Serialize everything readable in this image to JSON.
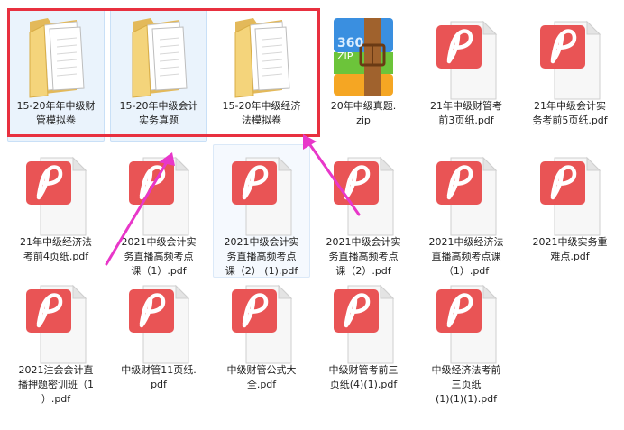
{
  "window": {
    "view": "large-icons",
    "selected_items": [
      "folder-mgmt-mock",
      "folder-accounting-real"
    ]
  },
  "files": [
    {
      "id": "folder-mgmt-mock",
      "type": "folder",
      "icon": "folder-icon",
      "label": "15-20年年中级财\n管模拟卷"
    },
    {
      "id": "folder-accounting-real",
      "type": "folder",
      "icon": "folder-icon",
      "label": "15-20年中级会计\n实务真题"
    },
    {
      "id": "folder-law-mock",
      "type": "folder",
      "icon": "folder-icon",
      "label": "15-20年中级经济\n法模拟卷"
    },
    {
      "id": "zip-2020-real",
      "type": "zip",
      "icon": "zip-archive-icon",
      "label": "20年中级真题.\nzip"
    },
    {
      "id": "pdf-fin-3p",
      "type": "pdf",
      "icon": "pdf-file-icon",
      "label": "21年中级财管考\n前3页纸.pdf"
    },
    {
      "id": "pdf-acc-5p",
      "type": "pdf",
      "icon": "pdf-file-icon",
      "label": "21年中级会计实\n务考前5页纸.pdf"
    },
    {
      "id": "pdf-law-4p",
      "type": "pdf",
      "icon": "pdf-file-icon",
      "label": "21年中级经济法\n考前4页纸.pdf"
    },
    {
      "id": "pdf-acc-live-1",
      "type": "pdf",
      "icon": "pdf-file-icon",
      "label": "2021中级会计实\n务直播高频考点\n课（1）.pdf"
    },
    {
      "id": "pdf-acc-live-2-1",
      "type": "pdf",
      "icon": "pdf-file-icon",
      "label": "2021中级会计实\n务直播高频考点\n课（2） (1).pdf"
    },
    {
      "id": "pdf-acc-live-2",
      "type": "pdf",
      "icon": "pdf-file-icon",
      "label": "2021中级会计实\n务直播高频考点\n课（2）.pdf"
    },
    {
      "id": "pdf-law-live-1",
      "type": "pdf",
      "icon": "pdf-file-icon",
      "label": "2021中级经济法\n直播高频考点课\n（1）.pdf"
    },
    {
      "id": "pdf-acc-key",
      "type": "pdf",
      "icon": "pdf-file-icon",
      "label": "2021中级实务重\n难点.pdf"
    },
    {
      "id": "pdf-cpa-class",
      "type": "pdf",
      "icon": "pdf-file-icon",
      "label": "2021注会会计直\n播押题密训班（1\n）.pdf"
    },
    {
      "id": "pdf-fin-11p",
      "type": "pdf",
      "icon": "pdf-file-icon",
      "label": "中级财管11页纸.\npdf"
    },
    {
      "id": "pdf-fin-formula",
      "type": "pdf",
      "icon": "pdf-file-icon",
      "label": "中级财管公式大\n全.pdf"
    },
    {
      "id": "pdf-fin-3p-4",
      "type": "pdf",
      "icon": "pdf-file-icon",
      "label": "中级财管考前三\n页纸(4)(1).pdf"
    },
    {
      "id": "pdf-law-3p",
      "type": "pdf",
      "icon": "pdf-file-icon",
      "label": "中级经济法考前\n三页纸\n(1)(1)(1).pdf"
    }
  ],
  "annotations": {
    "highlight_color": "#e8303f",
    "arrow_color": "#e837c9",
    "box_around": [
      "folder-mgmt-mock",
      "folder-accounting-real",
      "folder-law-mock"
    ]
  },
  "colors": {
    "folder_front": "#f4d47b",
    "folder_back": "#e3b95a",
    "pdf_badge": "#e95455",
    "zip_blue": "#3a8fe0",
    "zip_green": "#6cc43a",
    "zip_orange": "#f5a623",
    "zip_strap": "#a0622d",
    "selection_bg": "#eaf3fc"
  }
}
